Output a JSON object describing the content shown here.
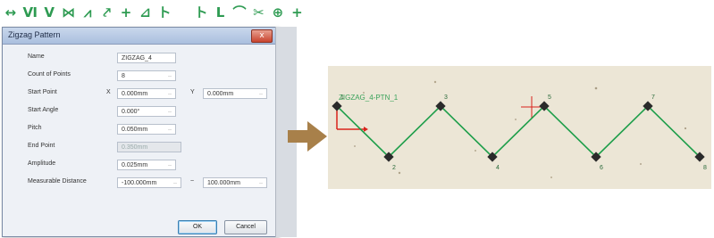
{
  "toolbar": {
    "icons": [
      {
        "name": "line-arrow-icon",
        "glyph": "↔"
      },
      {
        "name": "zigzag-icon",
        "glyph": "Ⅵ"
      },
      {
        "name": "zigzag-down-icon",
        "glyph": "V"
      },
      {
        "name": "bowtie-icon",
        "glyph": "⋈"
      },
      {
        "name": "diagonal-icon",
        "glyph": "⩘"
      },
      {
        "name": "zigzag-arrow-icon",
        "glyph": "⤤"
      },
      {
        "name": "cross-icon",
        "glyph": "+"
      },
      {
        "name": "ruler-icon",
        "glyph": "⊿"
      },
      {
        "name": "step-icon",
        "glyph": "ト"
      },
      {
        "name": "step-two-icon",
        "glyph": "ト"
      },
      {
        "name": "corner-icon",
        "glyph": "L"
      },
      {
        "name": "spline-icon",
        "glyph": "⌒"
      },
      {
        "name": "cut-icon",
        "glyph": "✂"
      },
      {
        "name": "fiducial-icon",
        "glyph": "⊕"
      },
      {
        "name": "line-plus-icon",
        "glyph": "+"
      }
    ],
    "icon_color": "#2e9b52"
  },
  "dialog": {
    "title": "Zigzag Pattern",
    "close_label": "x",
    "name": {
      "label": "Name",
      "value": "ZIGZAG_4"
    },
    "count_of_points": {
      "label": "Count of Points",
      "value": "8"
    },
    "start_point": {
      "label": "Start Point",
      "x_label": "X",
      "x_value": "0.000mm",
      "y_label": "Y",
      "y_value": "0.000mm"
    },
    "start_angle": {
      "label": "Start Angle",
      "value": "0.000°"
    },
    "pitch": {
      "label": "Pitch",
      "value": "0.050mm"
    },
    "end_point": {
      "label": "End Point",
      "value": "0.350mm"
    },
    "amplitude": {
      "label": "Amplitude",
      "value": "0.025mm"
    },
    "measurable_distance": {
      "label": "Measurable Distance",
      "min_value": "-100.000mm",
      "separator": "~",
      "max_value": "100.000mm"
    },
    "ok_label": "OK",
    "cancel_label": "Cancel"
  },
  "arrow_color": "#a8804a",
  "preview": {
    "pattern_label": "ZIGZAG_4-PTN_1",
    "point_labels": [
      "1",
      "2",
      "3",
      "4",
      "5",
      "6",
      "7",
      "8"
    ],
    "line_color": "#1e9e4a",
    "marker_color": "#2a2a2a",
    "origin_axis_color": "#d9231c"
  }
}
